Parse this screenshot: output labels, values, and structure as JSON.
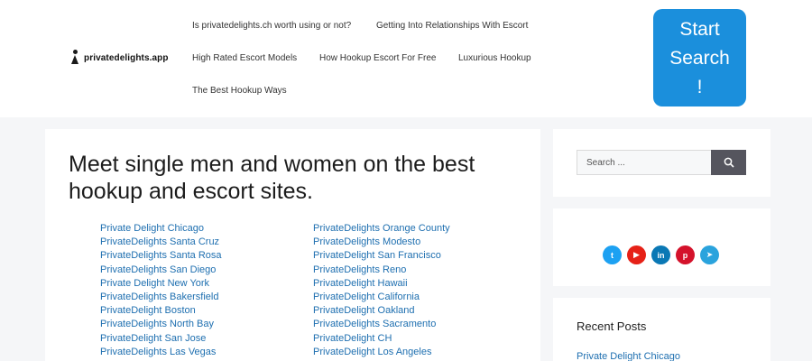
{
  "header": {
    "logo_text": "privatedelights.app",
    "nav": [
      "Is privatedelights.ch worth using or not?",
      "Getting Into Relationships With Escort",
      "High Rated Escort Models",
      "How Hookup Escort For Free",
      "Luxurious Hookup",
      "The Best Hookup Ways"
    ],
    "cta_line1": "Start",
    "cta_line2": "Search",
    "cta_line3": "!"
  },
  "main": {
    "title": "Meet single men and women on the best hookup and escort sites.",
    "links_left": [
      "Private Delight Chicago",
      "PrivateDelights Santa Cruz",
      "PrivateDelights Santa Rosa",
      "PrivateDelights San Diego",
      "Private Delight New York",
      "PrivateDelights Bakersfield",
      "PrivateDelight Boston",
      "PrivateDelights North Bay",
      "PrivateDelight San Jose",
      "PrivateDelights Las Vegas"
    ],
    "links_right": [
      "PrivateDelights Orange County",
      "PrivateDelights Modesto",
      "PrivateDelight San Francisco",
      "PrivateDelights Reno",
      "PrivateDelight Hawaii",
      "PrivateDelight California",
      "PrivateDelight Oakland",
      "PrivateDelights Sacramento",
      "PrivateDelight CH",
      "PrivateDelight Los Angeles"
    ]
  },
  "sidebar": {
    "search_placeholder": "Search ...",
    "socials": [
      {
        "icon": "twitter-icon",
        "color": "#1da1f2",
        "glyph": "t"
      },
      {
        "icon": "youtube-icon",
        "color": "#e62117",
        "glyph": "▶"
      },
      {
        "icon": "linkedin-icon",
        "color": "#0a78b5",
        "glyph": "in"
      },
      {
        "icon": "pinterest-icon",
        "color": "#d4122b",
        "glyph": "p"
      },
      {
        "icon": "telegram-icon",
        "color": "#2aa3dd",
        "glyph": "➤"
      }
    ],
    "recent_title": "Recent Posts",
    "recent_posts": [
      "Private Delight Chicago"
    ]
  }
}
